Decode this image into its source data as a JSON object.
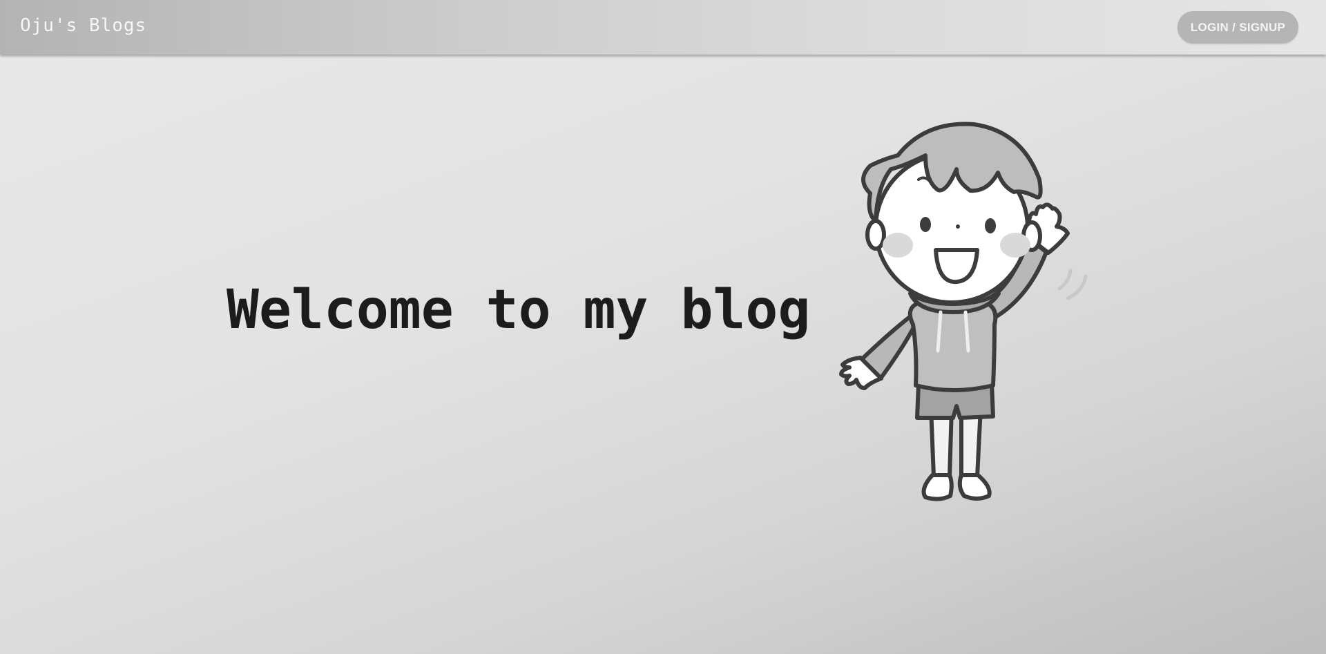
{
  "navbar": {
    "brand": "Oju's Blogs",
    "login_label": "LOGIN / SIGNUP"
  },
  "hero": {
    "title": "Welcome to my blog",
    "illustration": "waving-kid-illustration"
  },
  "colors": {
    "navbar_start": "#b3b3b3",
    "navbar_end": "#e6e6e6",
    "button_bg": "#b5b5b5",
    "title_text": "#1c1c1c"
  }
}
